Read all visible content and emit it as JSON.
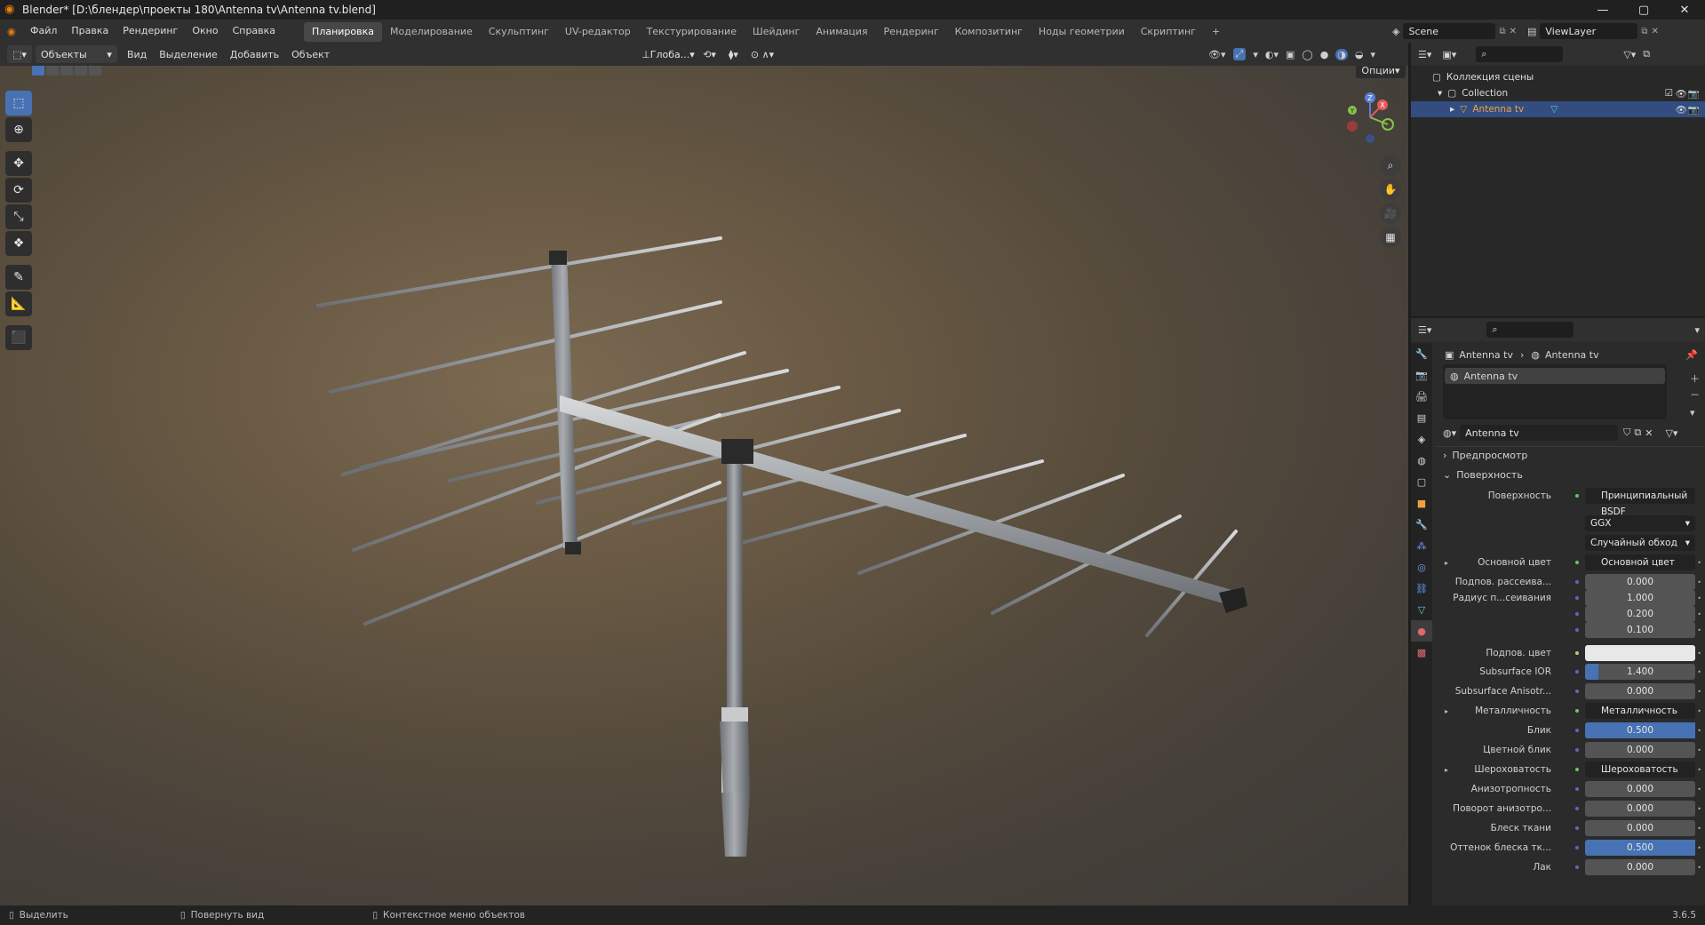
{
  "window": {
    "title": "Blender* [D:\\блендер\\проекты 180\\Antenna tv\\Antenna tv.blend]",
    "controls": [
      "—",
      "▢",
      "✕"
    ]
  },
  "menubar": {
    "items": [
      "Файл",
      "Правка",
      "Рендеринг",
      "Окно",
      "Справка"
    ],
    "workspaces": [
      "Планировка",
      "Моделирование",
      "Скульптинг",
      "UV-редактор",
      "Текстурирование",
      "Шейдинг",
      "Анимация",
      "Рендеринг",
      "Композитинг",
      "Ноды геометрии",
      "Скриптинг"
    ],
    "active_workspace": "Планировка",
    "scene": "Scene",
    "view_layer": "ViewLayer"
  },
  "viewport_header": {
    "mode": "Объекты",
    "items": [
      "Вид",
      "Выделение",
      "Добавить",
      "Объект"
    ],
    "orientation": "Глоба...",
    "options": "Опции"
  },
  "gizmo": {
    "z": "Z",
    "y": "Y",
    "x": "X"
  },
  "tools": [
    "select-box",
    "cursor",
    "move",
    "rotate",
    "scale",
    "transform",
    "annotate",
    "measure",
    "add-cube"
  ],
  "outliner": {
    "scene_collection": "Коллекция сцены",
    "collection": "Collection",
    "object": "Antenna tv"
  },
  "properties": {
    "breadcrumb": [
      "Antenna tv",
      "Antenna tv"
    ],
    "slot": "Antenna tv",
    "material": "Antenna tv",
    "panels": {
      "preview": "Предпросмотр",
      "surface": "Поверхность"
    },
    "surface_label": "Поверхность",
    "surface_value": "Принципиальный BSDF",
    "distribution": "GGX",
    "subsurface_method": "Случайный обход",
    "rows": [
      {
        "label": "Основной цвет",
        "value": "Основной цвет",
        "kind": "link",
        "expand": true
      },
      {
        "label": "Подпов. рассеива...",
        "value": "0.000",
        "kind": "num",
        "fill": 0
      },
      {
        "label": "Радиус п...сеивания",
        "value": "1.000",
        "kind": "num",
        "fill": 0
      },
      {
        "label": "",
        "value": "0.200",
        "kind": "num",
        "fill": 0
      },
      {
        "label": "",
        "value": "0.100",
        "kind": "num",
        "fill": 0
      },
      {
        "label": "Подпов. цвет",
        "value": "",
        "kind": "color",
        "color": "#e8e8e8"
      },
      {
        "label": "Subsurface IOR",
        "value": "1.400",
        "kind": "num",
        "fill": 0.12
      },
      {
        "label": "Subsurface Anisotr...",
        "value": "0.000",
        "kind": "num",
        "fill": 0
      },
      {
        "label": "Металличность",
        "value": "Металличность",
        "kind": "link",
        "expand": true
      },
      {
        "label": "Блик",
        "value": "0.500",
        "kind": "num",
        "fill": 1
      },
      {
        "label": "Цветной блик",
        "value": "0.000",
        "kind": "num",
        "fill": 0
      },
      {
        "label": "Шероховатость",
        "value": "Шероховатость",
        "kind": "link",
        "expand": true
      },
      {
        "label": "Анизотропность",
        "value": "0.000",
        "kind": "num",
        "fill": 0
      },
      {
        "label": "Поворот анизотро...",
        "value": "0.000",
        "kind": "num",
        "fill": 0
      },
      {
        "label": "Блеск ткани",
        "value": "0.000",
        "kind": "num",
        "fill": 0
      },
      {
        "label": "Оттенок блеска тк...",
        "value": "0.500",
        "kind": "num",
        "fill": 1
      },
      {
        "label": "Лак",
        "value": "0.000",
        "kind": "num",
        "fill": 0
      }
    ]
  },
  "statusbar": {
    "select": "Выделить",
    "rotate": "Повернуть вид",
    "context": "Контекстное меню объектов",
    "version": "3.6.5"
  }
}
